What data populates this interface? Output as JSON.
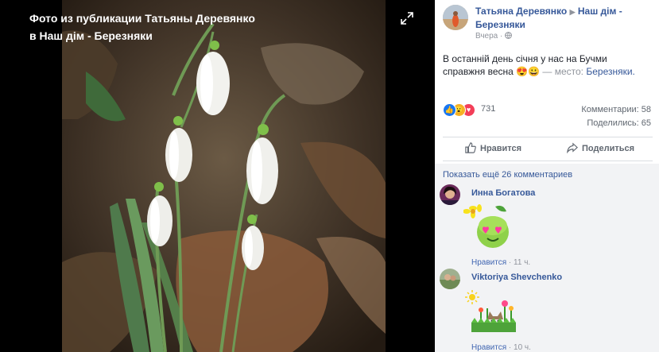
{
  "viewer": {
    "title": "Фото из публикации Татьяны Деревянко в Наш дім - Березняки",
    "expand_icon": "expand-arrows-icon"
  },
  "post": {
    "author": "Татьяна Деревянко",
    "group": "Наш дім - Березняки",
    "time": "Вчера",
    "privacy_icon": "globe-icon",
    "text": "В останній день січня у нас на Бучми справжня весна 😍😀",
    "place_prefix": "— место:",
    "place": "Березняки."
  },
  "stats": {
    "reactions": "731",
    "reaction_icons": [
      "like-icon",
      "wow-icon",
      "love-icon"
    ],
    "comments": "Комментарии: 58",
    "shares": "Поделились: 65"
  },
  "actions": {
    "like": "Нравится",
    "share": "Поделиться"
  },
  "comments": {
    "show_more": "Показать ещё 26 комментариев",
    "items": [
      {
        "name": "Инна Богатова",
        "like": "Нравится",
        "time": "11 ч.",
        "sticker": "heart-eyes-flower-sticker"
      },
      {
        "name": "Viktoriya Shevchenko",
        "like": "Нравится",
        "time": "10 ч.",
        "sticker": "cat-in-garden-sticker"
      }
    ]
  },
  "colors": {
    "link": "#365899",
    "meta": "#90949c",
    "comments_bg": "#f2f3f5"
  }
}
